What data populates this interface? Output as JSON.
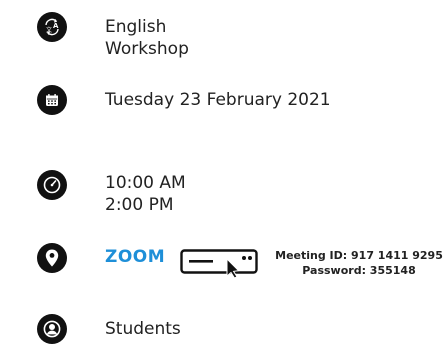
{
  "language": {
    "icon": "translate-icon",
    "line1": "English",
    "line2": "Workshop"
  },
  "date": {
    "icon": "calendar-icon",
    "value": "Tuesday 23 February 2021"
  },
  "time": {
    "icon": "clock-icon",
    "start": "10:00 AM",
    "end": "2:00 PM"
  },
  "location": {
    "icon": "location-pin-icon",
    "link_label": "ZOOM",
    "link_color": "#1e8fd8",
    "device_icon": "screen-click-icon",
    "meeting_id": "Meeting ID: 917 1411 9295",
    "password": "Password: 355148"
  },
  "audience": {
    "icon": "user-icon",
    "value": "Students"
  }
}
